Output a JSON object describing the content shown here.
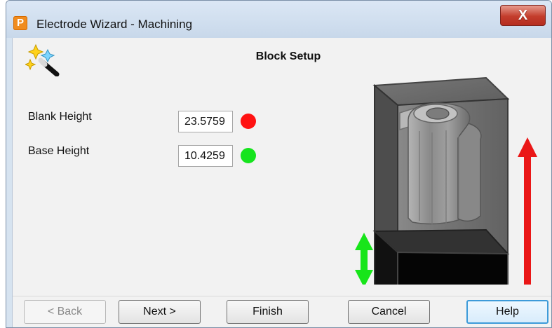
{
  "window": {
    "app_icon_letter": "P",
    "title": "Electrode Wizard - Machining",
    "close_label": "X"
  },
  "wizard": {
    "step_title": "Block Setup",
    "icon": "wizard-wand-icon"
  },
  "fields": {
    "blank_height": {
      "label": "Blank Height",
      "value": "23.5759",
      "indicator_color": "#ff1212",
      "indicator_name": "red-circle-icon"
    },
    "base_height": {
      "label": "Base Height",
      "value": "10.4259",
      "indicator_color": "#16e41e",
      "indicator_name": "green-circle-icon"
    }
  },
  "preview": {
    "blank_height_arrow_color": "#ea1717",
    "base_height_arrow_color": "#18e51a",
    "block_icon": "electrode-block-preview"
  },
  "buttons": {
    "back": "< Back",
    "next": "Next >",
    "finish": "Finish",
    "cancel": "Cancel",
    "help": "Help"
  }
}
